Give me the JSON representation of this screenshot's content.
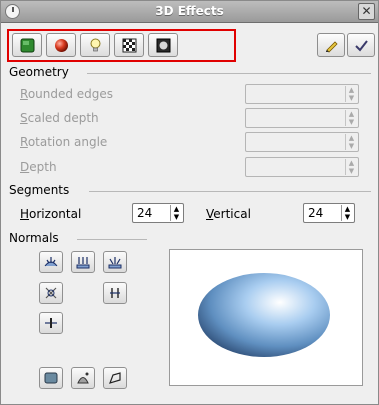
{
  "window": {
    "title": "3D Effects",
    "close_glyph": "✕"
  },
  "toolbar": {
    "buttons": [
      {
        "name": "geometry-mode",
        "icon": "green-square-icon"
      },
      {
        "name": "shading-mode",
        "icon": "red-sphere-icon"
      },
      {
        "name": "illumination-mode",
        "icon": "light-bulb-icon"
      },
      {
        "name": "textures-mode",
        "icon": "checker-texture-icon"
      },
      {
        "name": "material-mode",
        "icon": "material-icon"
      }
    ],
    "right_buttons": [
      {
        "name": "assign",
        "icon": "pen-icon"
      },
      {
        "name": "update",
        "icon": "checkmark-icon"
      }
    ]
  },
  "geometry": {
    "heading": "Geometry",
    "rows": [
      {
        "mnemonic": "R",
        "rest": "ounded edges"
      },
      {
        "mnemonic": "S",
        "rest": "caled depth"
      },
      {
        "mnemonic": "R",
        "rest": "otation angle"
      },
      {
        "mnemonic": "D",
        "rest": "epth"
      }
    ]
  },
  "segments": {
    "heading": "Segments",
    "horizontal": {
      "mnemonic": "H",
      "rest": "orizontal",
      "value": "24"
    },
    "vertical": {
      "mnemonic": "V",
      "rest": "ertical",
      "value": "24"
    }
  },
  "normals": {
    "heading": "Normals"
  },
  "colors": {
    "highlight_frame": "#e00000",
    "window_bg": "#efefef",
    "sphere_light": "#ffffff",
    "sphere_mid": "#7fb4e6",
    "sphere_dark": "#2d4f7c"
  }
}
